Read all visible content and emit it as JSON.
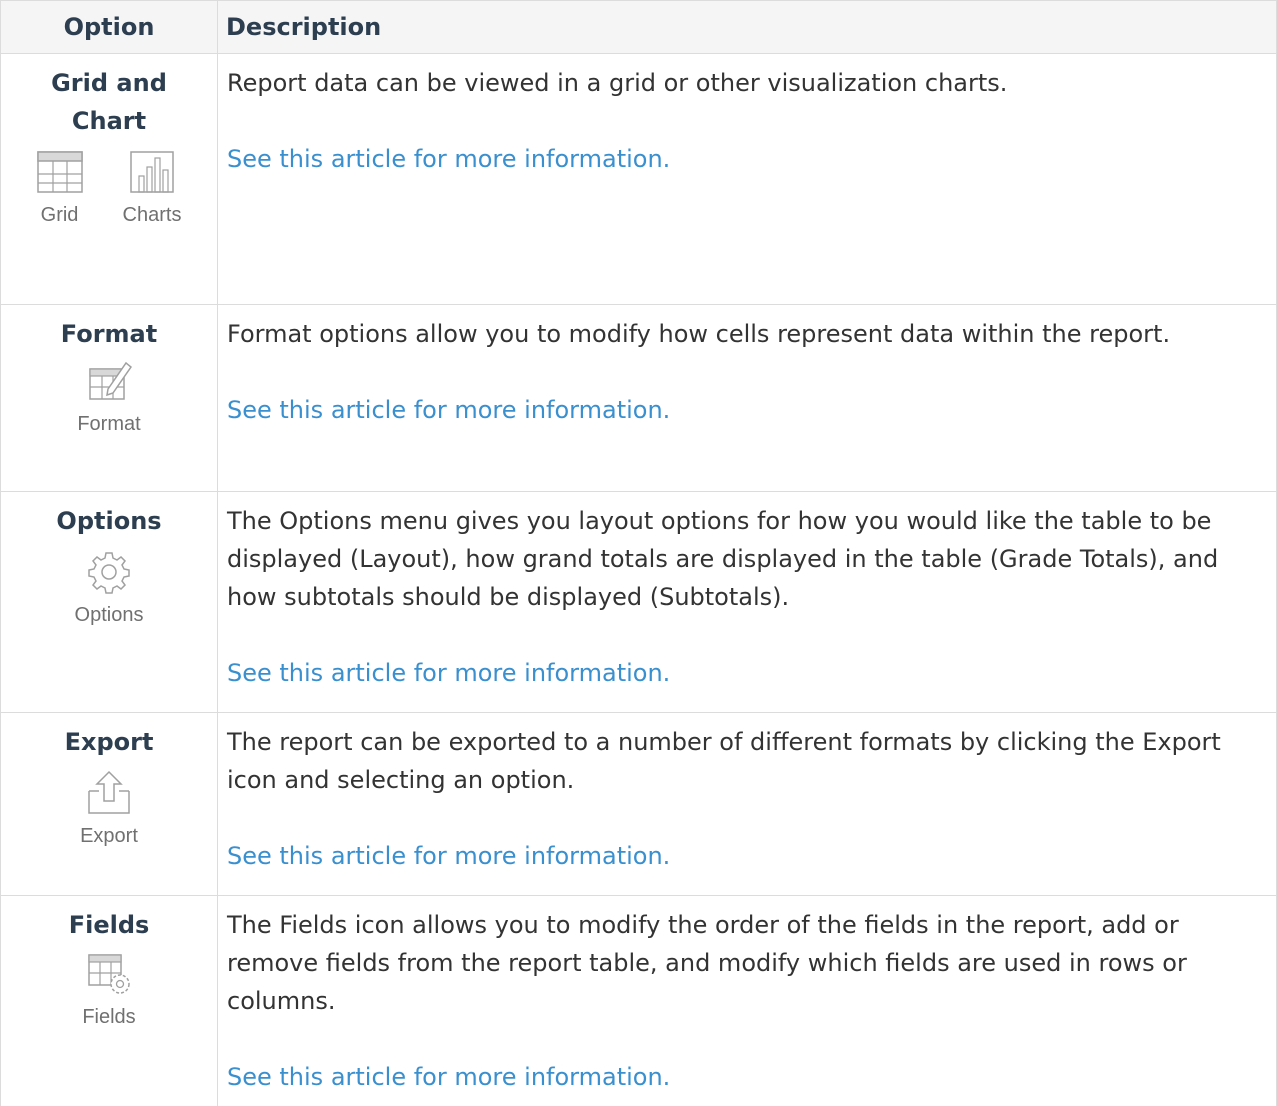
{
  "header": {
    "option": "Option",
    "description": "Description"
  },
  "rows": [
    {
      "title": "Grid and Chart",
      "icons": [
        {
          "name": "grid-icon",
          "label": "Grid"
        },
        {
          "name": "charts-icon",
          "label": "Charts"
        }
      ],
      "description": "Report data can be viewed in a grid or other visualization charts.",
      "link": "See this article for more information."
    },
    {
      "title": "Format",
      "icons": [
        {
          "name": "format-icon",
          "label": "Format"
        }
      ],
      "description": "Format options allow you to modify how cells represent data within the report.",
      "link": "See this article for more information."
    },
    {
      "title": "Options",
      "icons": [
        {
          "name": "gear-icon",
          "label": "Options"
        }
      ],
      "description": "The Options menu gives you layout options for how you would like the table to be displayed (Layout), how grand totals are displayed in the table (Grade Totals), and how subtotals should be displayed (Subtotals).",
      "link": "See this article for more information."
    },
    {
      "title": "Export",
      "icons": [
        {
          "name": "export-icon",
          "label": "Export"
        }
      ],
      "description": "The report can be exported to a number of different formats by clicking the Export icon and selecting an option.",
      "link": "See this article for more information."
    },
    {
      "title": "Fields",
      "icons": [
        {
          "name": "fields-icon",
          "label": "Fields"
        }
      ],
      "description": "The Fields icon allows you to modify the order of the fields in the report, add or remove fields from the report table, and modify which fields are used in rows or columns.",
      "link": "See this article for more information."
    }
  ],
  "colors": {
    "link": "#3a8fcf",
    "header_bg": "#f5f5f5",
    "icon_gray": "#9a9a9a"
  }
}
